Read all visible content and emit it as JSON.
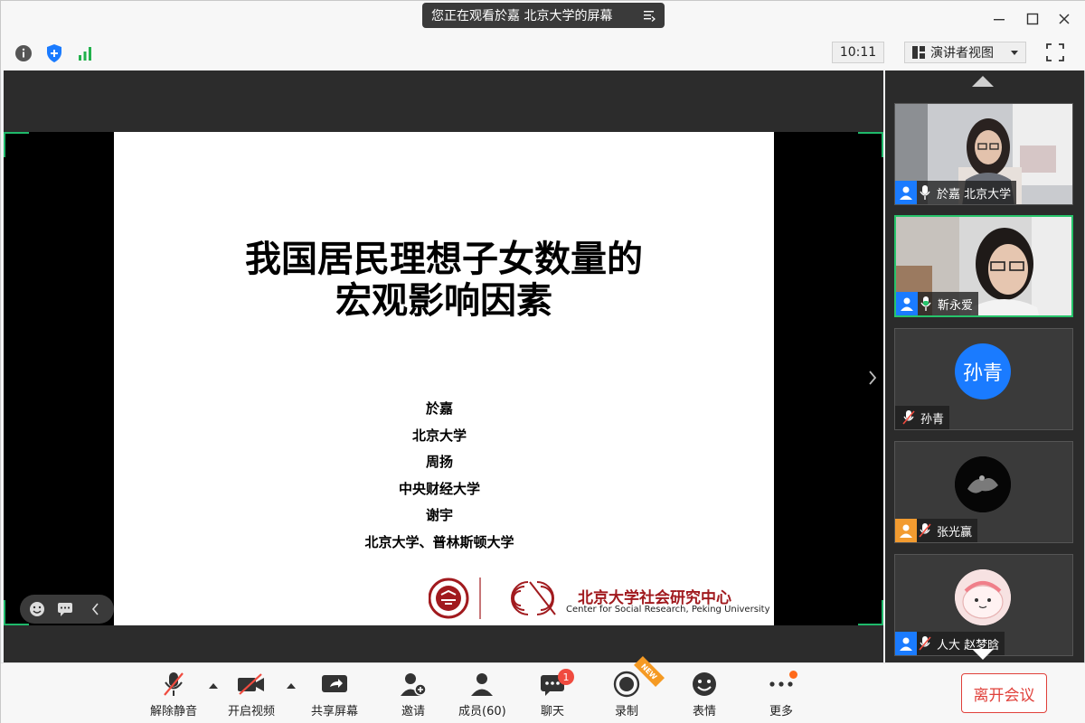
{
  "title_bar": {
    "share_banner": "您正在观看於嘉 北京大学的屏幕"
  },
  "status_bar": {
    "clock": "10:11",
    "view_mode": "演讲者视图"
  },
  "slide": {
    "title_line1": "我国居民理想子女数量的",
    "title_line2": "宏观影响因素",
    "authors": [
      "於嘉",
      "北京大学",
      "周扬",
      "中央财经大学",
      "谢宇",
      "北京大学、普林斯顿大学"
    ],
    "logo_cn": "北京大学社会研究中心",
    "logo_en": "Center for Social Research, Peking University"
  },
  "participants": [
    {
      "name": "於嘉 北京大学",
      "video": true,
      "muted": false,
      "active": false
    },
    {
      "name": "靳永爱",
      "video": true,
      "muted": false,
      "active": true
    },
    {
      "name": "孙青",
      "video": false,
      "muted": true,
      "avatar_text": "孙青",
      "avatar_color": "#1a7bff"
    },
    {
      "name": "张光赢",
      "video": false,
      "muted": true
    },
    {
      "name": "人大 赵梦晗",
      "video": false,
      "muted": true
    }
  ],
  "toolbar": {
    "unmute": "解除静音",
    "start_video": "开启视频",
    "share_screen": "共享屏幕",
    "invite": "邀请",
    "members": "成员(60)",
    "chat": "聊天",
    "chat_badge": "1",
    "record": "录制",
    "record_tag": "NEW",
    "reactions": "表情",
    "more": "更多",
    "leave": "离开会议"
  },
  "colors": {
    "accent_green": "#27c46b",
    "leave_red": "#e0403a",
    "badge_red": "#f04b3f"
  }
}
